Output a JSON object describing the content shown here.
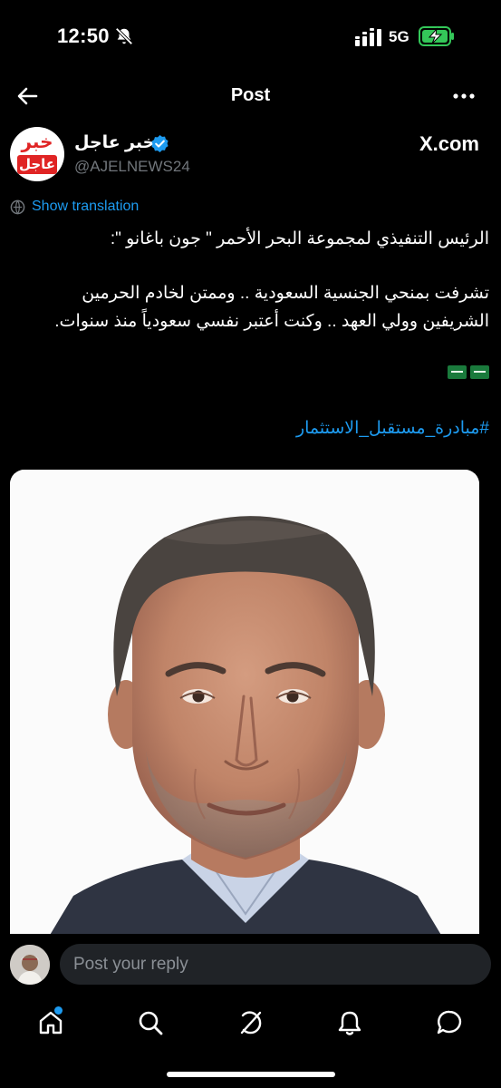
{
  "status_bar": {
    "time": "12:50",
    "network": "5G"
  },
  "header": {
    "title": "Post"
  },
  "author": {
    "avatar_line1": "خبر",
    "avatar_line2": "عاجل",
    "name": "خبر عاجل",
    "handle": "@AJELNEWS24",
    "source": "X.com"
  },
  "translation_label": "Show translation",
  "tweet": {
    "line1": "الرئيس التنفيذي لمجموعة البحر الأحمر \" جون باغانو \":",
    "line2": "تشرفت بمنحي الجنسية السعودية .. وممتن لخادم الحرمين",
    "line3": "الشريفين وولي العهد .. وكنت أعتبر نفسي سعودياً منذ سنوات.",
    "hashtag": "#مبادرة_مستقبل_الاستثمار"
  },
  "reply": {
    "placeholder": "Post your reply"
  },
  "tabs": [
    "home",
    "search",
    "grok",
    "notifications",
    "messages"
  ],
  "colors": {
    "accent": "#1d9bf0",
    "background": "#000000",
    "input_bg": "#202327",
    "secondary_text": "#71767b",
    "battery": "#34c759"
  }
}
